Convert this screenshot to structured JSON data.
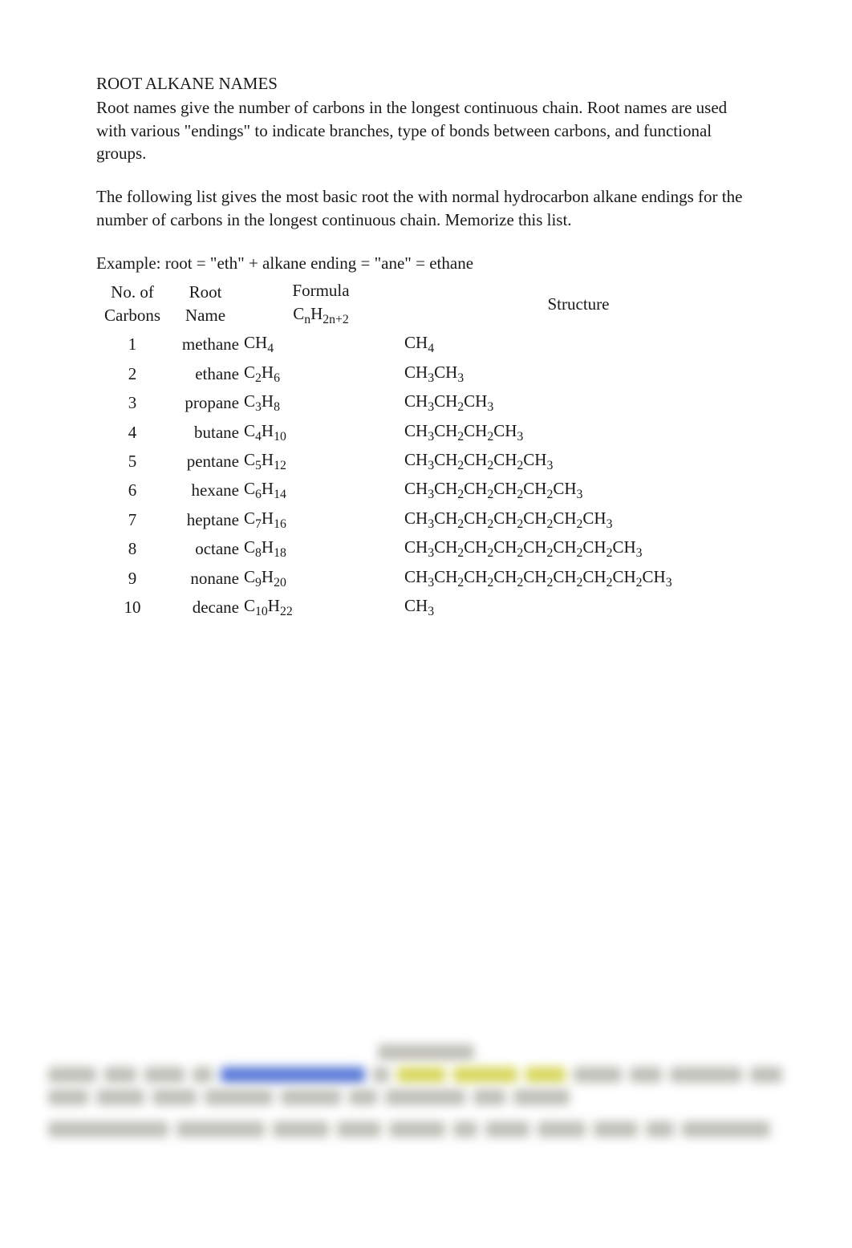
{
  "title": "ROOT ALKANE NAMES",
  "intro": "Root names give the number of carbons in the longest continuous chain. Root names are used with various \"endings\" to indicate branches, type of bonds between carbons, and functional groups.",
  "note": "The following list gives the most basic root the with normal hydrocarbon alkane endings for the number of carbons in the longest continuous chain. Memorize this list.",
  "example": "Example: root = \"eth\" + alkane ending = \"ane\" = ethane",
  "headers": {
    "carbons_l1": "No. of",
    "carbons_l2": "Carbons",
    "name_l1": "Root",
    "name_l2": "Name",
    "formula_l1": "Formula",
    "formula_prefix": "C",
    "formula_sub1": "n",
    "formula_mid": "H",
    "formula_sub2": "2n+2",
    "structure": "Structure"
  },
  "rows": [
    {
      "n": "1",
      "name": "methane",
      "f_cn": "",
      "f_c": "C",
      "f_h": "H",
      "f_hn": "4",
      "structure_parts": [
        "CH",
        "4"
      ]
    },
    {
      "n": "2",
      "name": "ethane",
      "f_cn": "2",
      "f_c": "C",
      "f_h": "H",
      "f_hn": "6",
      "structure_parts": [
        "CH",
        "3",
        "CH",
        "3"
      ]
    },
    {
      "n": "3",
      "name": "propane",
      "f_cn": "3",
      "f_c": "C",
      "f_h": "H",
      "f_hn": "8",
      "structure_parts": [
        "CH",
        "3",
        "CH",
        "2",
        "CH",
        "3"
      ]
    },
    {
      "n": "4",
      "name": "butane",
      "f_cn": "4",
      "f_c": "C",
      "f_h": "H",
      "f_hn": "10",
      "structure_parts": [
        "CH",
        "3",
        "CH",
        "2",
        "CH",
        "2",
        "CH",
        "3"
      ]
    },
    {
      "n": "5",
      "name": "pentane",
      "f_cn": "5",
      "f_c": "C",
      "f_h": "H",
      "f_hn": "12",
      "structure_parts": [
        "CH",
        "3",
        "CH",
        "2",
        "CH",
        "2",
        "CH",
        "2",
        "CH",
        "3"
      ]
    },
    {
      "n": "6",
      "name": "hexane",
      "f_cn": "6",
      "f_c": "C",
      "f_h": "H",
      "f_hn": "14",
      "structure_parts": [
        "CH",
        "3",
        "CH",
        "2",
        "CH",
        "2",
        "CH",
        "2",
        "CH",
        "2",
        "CH",
        "3"
      ]
    },
    {
      "n": "7",
      "name": "heptane",
      "f_cn": "7",
      "f_c": "C",
      "f_h": "H",
      "f_hn": "16",
      "structure_parts": [
        "CH",
        "3",
        "CH",
        "2",
        "CH",
        "2",
        "CH",
        "2",
        "CH",
        "2",
        "CH",
        "2",
        "CH",
        "3"
      ]
    },
    {
      "n": "8",
      "name": "octane",
      "f_cn": "8",
      "f_c": "C",
      "f_h": "H",
      "f_hn": "18",
      "structure_parts": [
        "CH",
        "3",
        "CH",
        "2",
        "CH",
        "2",
        "CH",
        "2",
        "CH",
        "2",
        "CH",
        "2",
        "CH",
        "2",
        "CH",
        "3"
      ]
    },
    {
      "n": "9",
      "name": "nonane",
      "f_cn": "9",
      "f_c": "C",
      "f_h": "H",
      "f_hn": "20",
      "structure_parts": [
        "CH",
        "3",
        "CH",
        "2",
        "CH",
        "2",
        "CH",
        "2",
        "CH",
        "2",
        "CH",
        "2",
        "CH",
        "2",
        "CH",
        "2",
        "CH",
        "3"
      ]
    },
    {
      "n": "10",
      "name": "decane",
      "f_cn": "10",
      "f_c": "C",
      "f_h": "H",
      "f_hn": "22",
      "structure_parts": [
        "CH",
        "3"
      ]
    }
  ]
}
